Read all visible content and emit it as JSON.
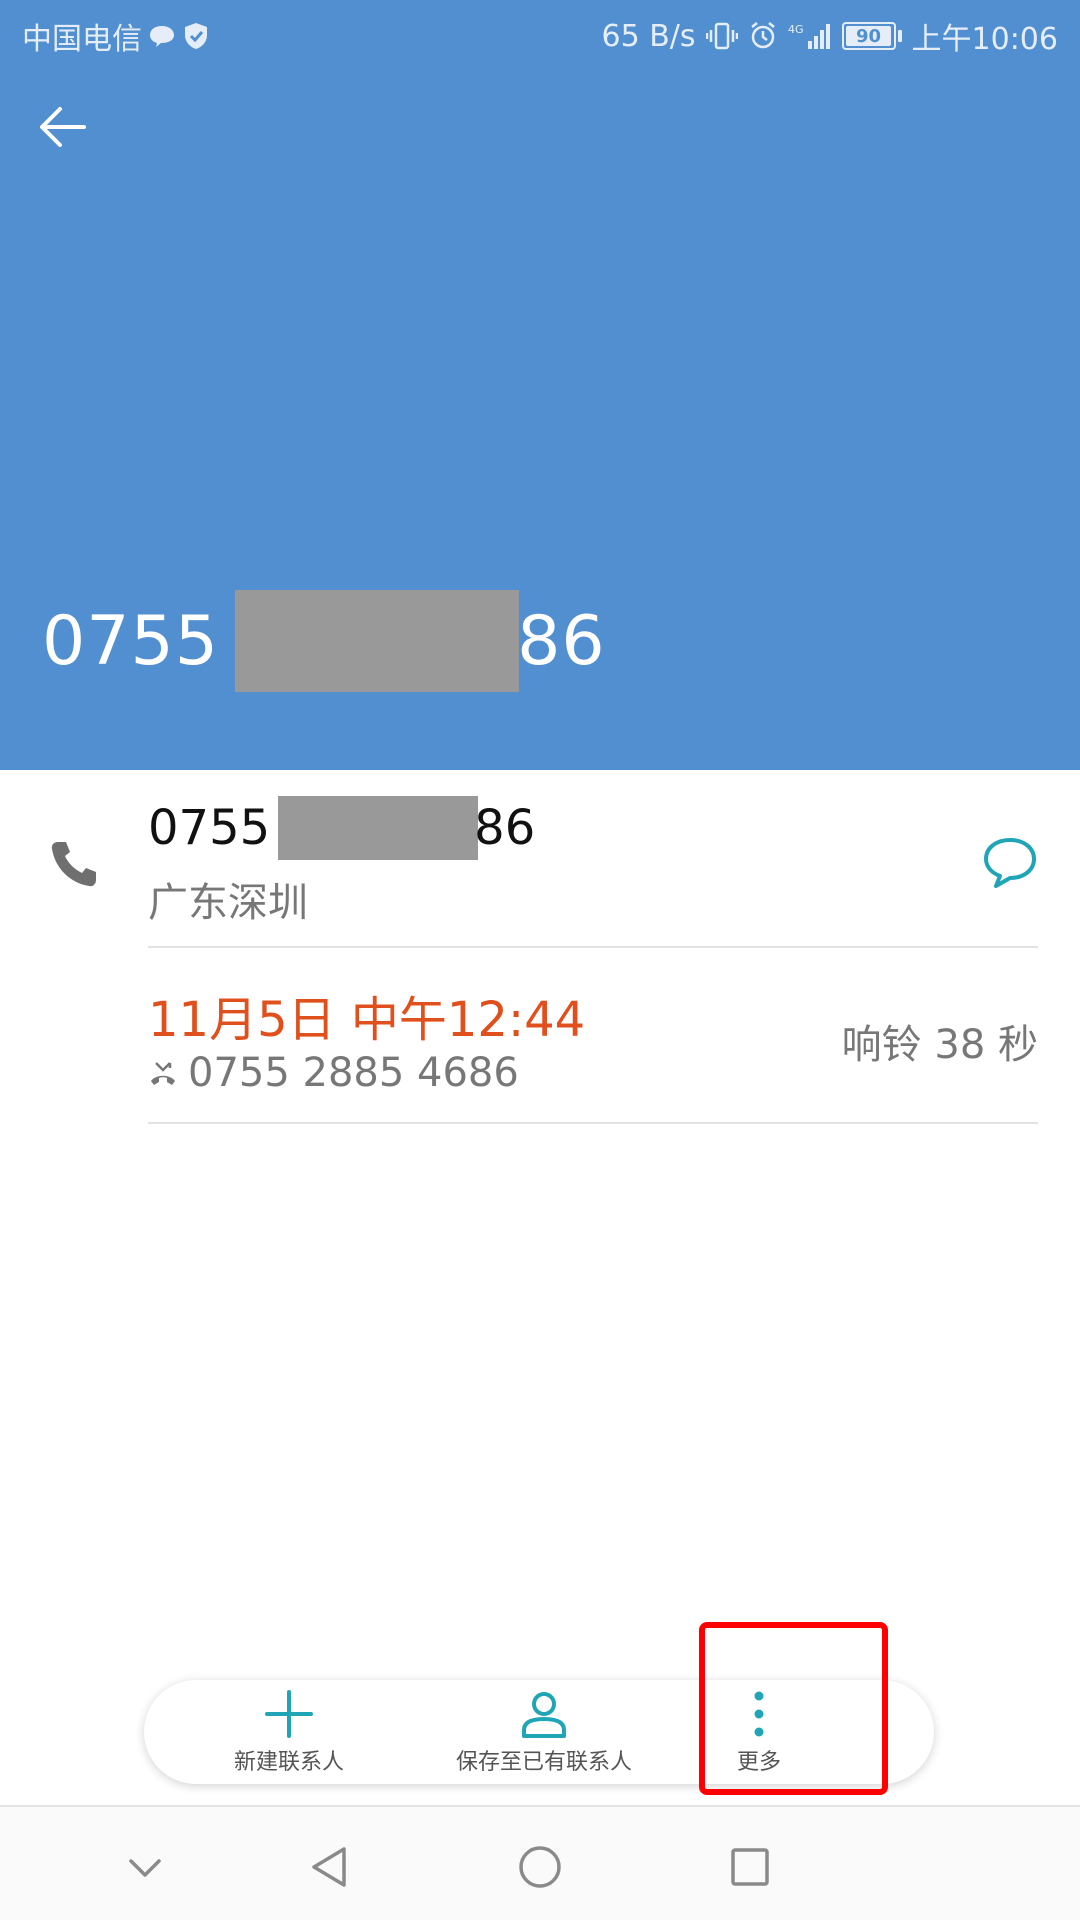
{
  "status_bar": {
    "carrier": "中国电信",
    "speed": "65 B/s",
    "network": "4G",
    "battery": "90",
    "time": "上午10:06"
  },
  "header": {
    "number_prefix": "0755",
    "number_suffix": "86"
  },
  "details": {
    "number_prefix": "0755",
    "number_suffix": "86",
    "location": "广东深圳"
  },
  "call_record": {
    "time": "11月5日 中午12:44",
    "called_number": "0755 2885 4686",
    "duration": "响铃 38 秒"
  },
  "actions": {
    "new_contact": "新建联系人",
    "save_existing": "保存至已有联系人",
    "more": "更多"
  },
  "colors": {
    "header_bg": "#518fd0",
    "accent": "#1fa5b6",
    "missed": "#e0501d",
    "highlight": "#ff0000"
  }
}
